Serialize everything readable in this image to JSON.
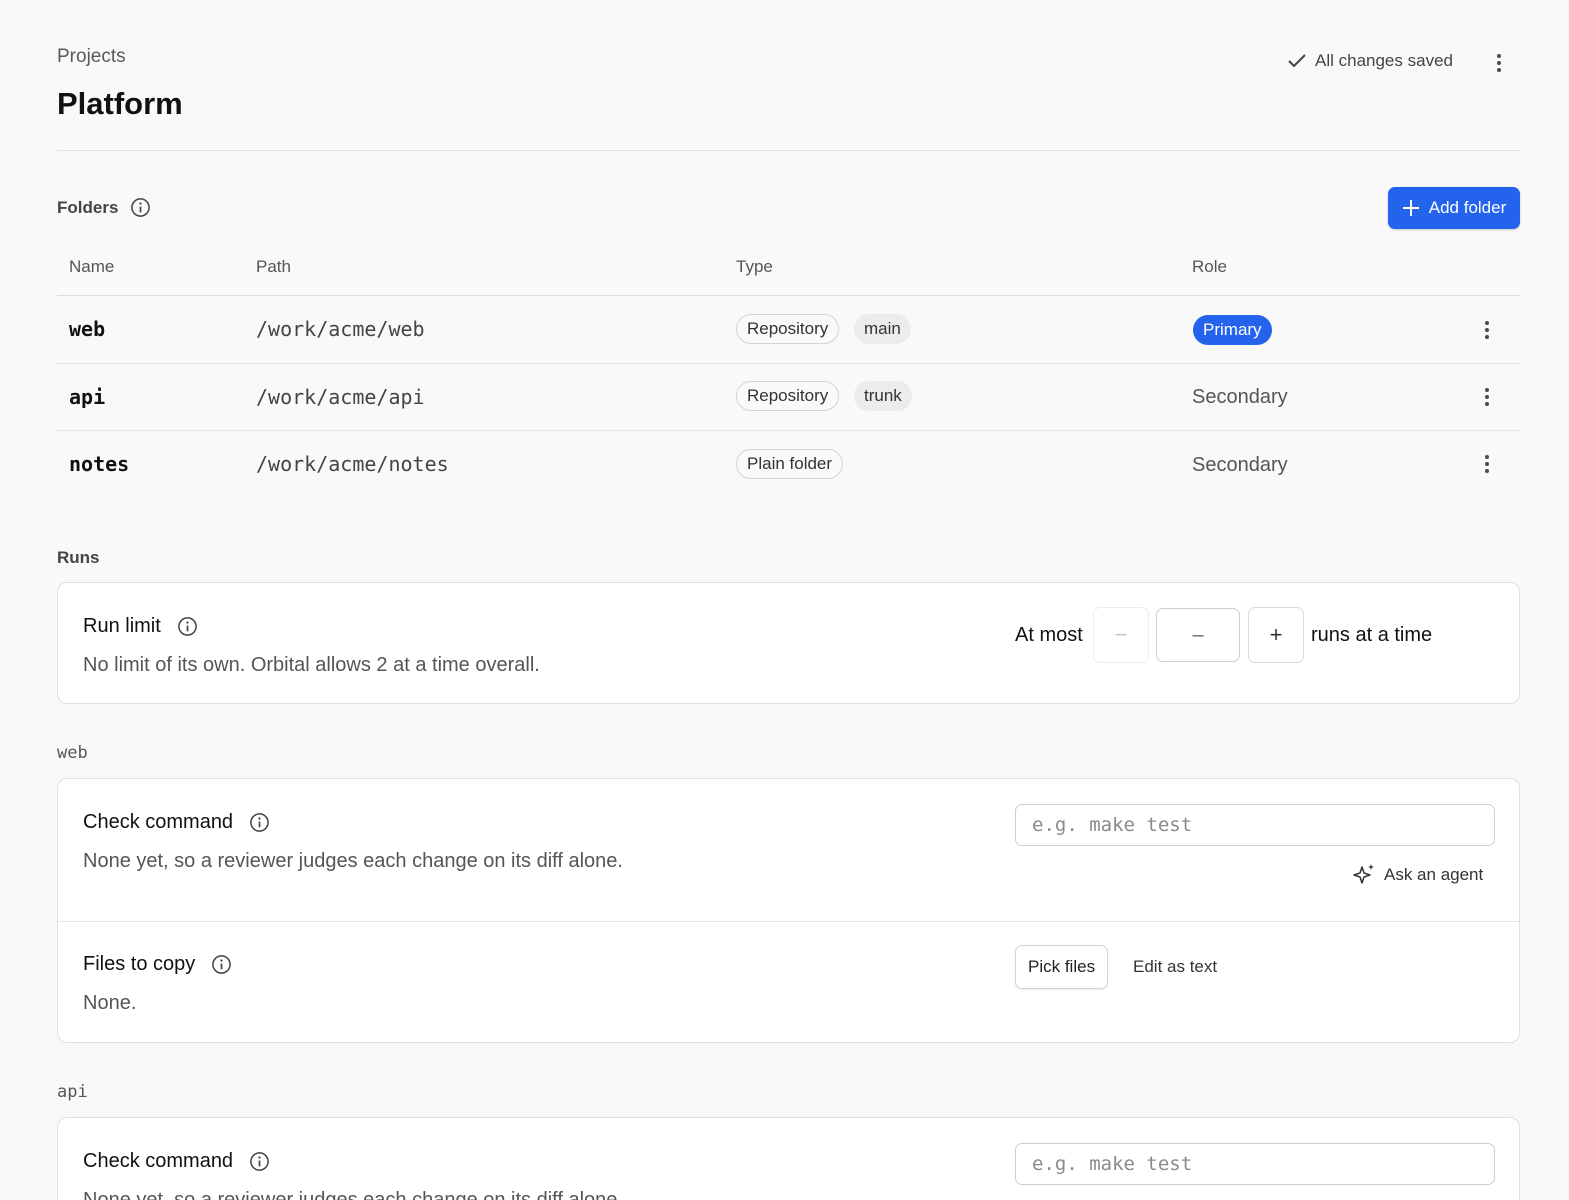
{
  "header": {
    "breadcrumb": "Projects",
    "title": "Platform",
    "save_status": "All changes saved"
  },
  "folders": {
    "label": "Folders",
    "add_button": "Add folder",
    "columns": [
      "Name",
      "Path",
      "Type",
      "Role"
    ],
    "rows": [
      {
        "name": "web",
        "path": "/work/acme/web",
        "type": "Repository",
        "branch": "main",
        "role": "Primary"
      },
      {
        "name": "api",
        "path": "/work/acme/api",
        "type": "Repository",
        "branch": "trunk",
        "role": "Secondary"
      },
      {
        "name": "notes",
        "path": "/work/acme/notes",
        "type": "Plain folder",
        "branch": "",
        "role": "Secondary"
      }
    ]
  },
  "runs": {
    "label": "Runs",
    "title": "Run limit",
    "description": "No limit of its own. Orbital allows 2 at a time overall.",
    "prefix": "At most",
    "value": "–",
    "suffix": "runs at a time",
    "minus": "−",
    "plus": "+"
  },
  "web_section": {
    "label": "web",
    "check_title": "Check command",
    "check_description": "None yet, so a reviewer judges each change on its diff alone.",
    "check_placeholder": "e.g. make test",
    "ask_agent": "Ask an agent",
    "files_title": "Files to copy",
    "files_description": "None.",
    "pick_files": "Pick files",
    "edit_as_text": "Edit as text"
  },
  "api_section": {
    "label": "api",
    "check_title": "Check command",
    "check_description": "None yet, so a reviewer judges each change on its diff alone.",
    "check_placeholder": "e.g. make test"
  },
  "colors": {
    "accent": "#2463eb",
    "background": "#f9f9f9"
  },
  "icons": [
    "check-icon",
    "more-vertical-icon",
    "info-icon",
    "plus-icon",
    "sparkles-icon"
  ]
}
